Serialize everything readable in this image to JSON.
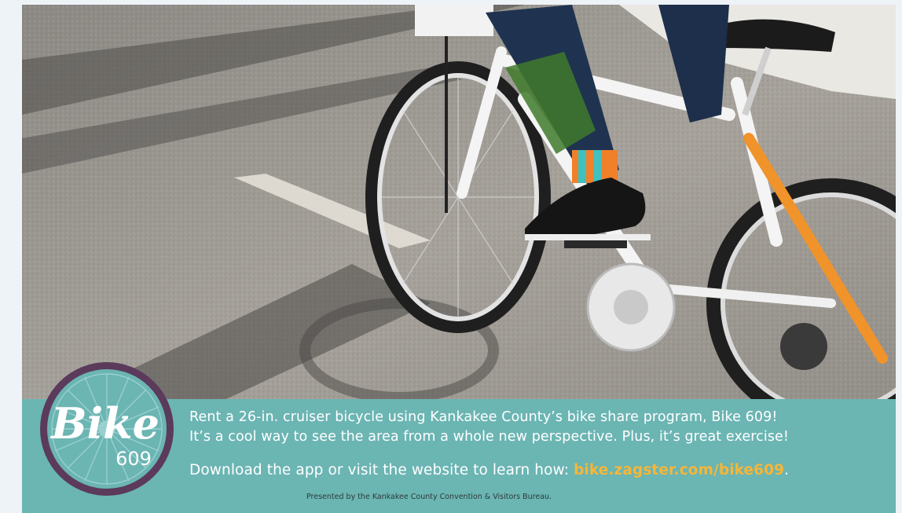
{
  "promo": {
    "line1": "Rent a 26-in. cruiser bicycle using Kankakee County’s bike share program, Bike 609!",
    "line2": "It’s a cool way to see the area from a whole new perspective. Plus, it’s great exercise!",
    "download_text": "Download the app or visit the website to learn how:",
    "url": "bike.zagster.com/bike609",
    "url_suffix": ".",
    "credit": "Presented by the Kankakee County Convention & Visitors Bureau."
  },
  "logo": {
    "word": "Bike",
    "number": "609",
    "icon": "bicycle-wheel-icon"
  },
  "photo": {
    "subject": "person riding white cruiser bicycle on asphalt",
    "icon": "bicycle-photo"
  },
  "colors": {
    "banner": "#6bb5b3",
    "logo_ring": "#5b3a5c",
    "logo_fill": "#6bb5b3",
    "url": "#f6b638",
    "frame_orange": "#f0932b"
  }
}
